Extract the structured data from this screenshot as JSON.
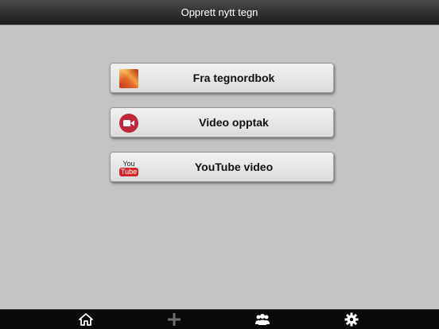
{
  "header": {
    "title": "Opprett nytt tegn"
  },
  "options": [
    {
      "label": "Fra tegnordbok",
      "icon": "dictionary-image-icon"
    },
    {
      "label": "Video opptak",
      "icon": "video-camera-icon"
    },
    {
      "label": "YouTube video",
      "icon": "youtube-logo-icon",
      "logo_you": "You",
      "logo_tube": "Tube"
    }
  ],
  "tabbar": {
    "items": [
      {
        "icon": "home-icon",
        "active": true
      },
      {
        "icon": "plus-icon",
        "active": false
      },
      {
        "icon": "group-icon",
        "active": true
      },
      {
        "icon": "gear-icon",
        "active": true
      }
    ]
  },
  "colors": {
    "background": "#c4c4c4",
    "header": "#2a2a2a",
    "tabbar": "#0a0a0a",
    "video_icon": "#c0283a",
    "youtube_red": "#d3262a"
  }
}
